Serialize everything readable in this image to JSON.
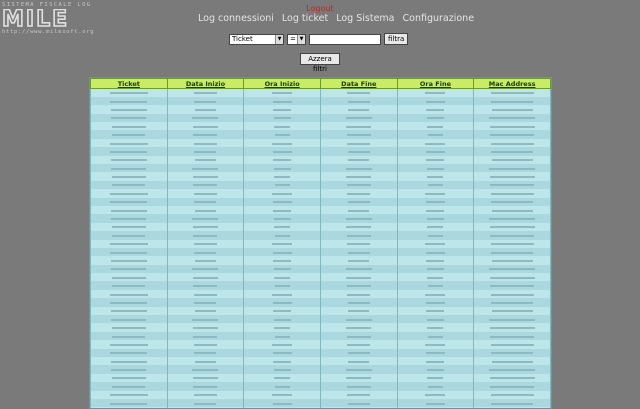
{
  "logo": {
    "top_text": "SISTEMA FISCALE LOG",
    "brand": "MILE",
    "url_text": "http://www.milesoft.org"
  },
  "nav": {
    "logout": "Logout",
    "items": [
      "Log connessioni",
      "Log ticket",
      "Log Sistema",
      "Configurazione"
    ]
  },
  "filter": {
    "field_selected": "Ticket",
    "operator_selected": "=",
    "value": "",
    "filter_button": "filtra",
    "reset_button": "Azzera filtri"
  },
  "table": {
    "columns": [
      "Ticket",
      "Data Inizio",
      "Ora Inizio",
      "Data Fine",
      "Ora Fine",
      "Mac Address"
    ],
    "row_count": 39
  },
  "colors": {
    "background": "#7a7a7a",
    "header": "#c8ec62",
    "row": "#b7e2e6",
    "logout": "#cc2222"
  }
}
